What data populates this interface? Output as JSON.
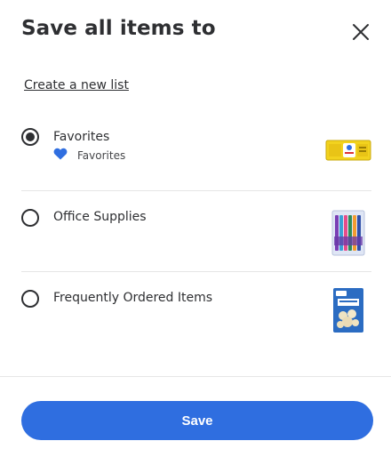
{
  "dialog": {
    "title": "Save all items to",
    "close_icon": "close-icon",
    "create_link": "Create a new list"
  },
  "lists": [
    {
      "name": "Favorites",
      "selected": true,
      "sub_label": "Favorites",
      "sub_icon": "heart-icon",
      "thumbnail": "product-thumbnail"
    },
    {
      "name": "Office Supplies",
      "selected": false,
      "thumbnail": "product-thumbnail"
    },
    {
      "name": "Frequently Ordered Items",
      "selected": false,
      "thumbnail": "product-thumbnail"
    }
  ],
  "footer": {
    "save_label": "Save"
  },
  "colors": {
    "accent": "#2f6ee0",
    "heart": "#2f6ee0",
    "text": "#2e2f32",
    "divider": "#e6e6e6"
  }
}
